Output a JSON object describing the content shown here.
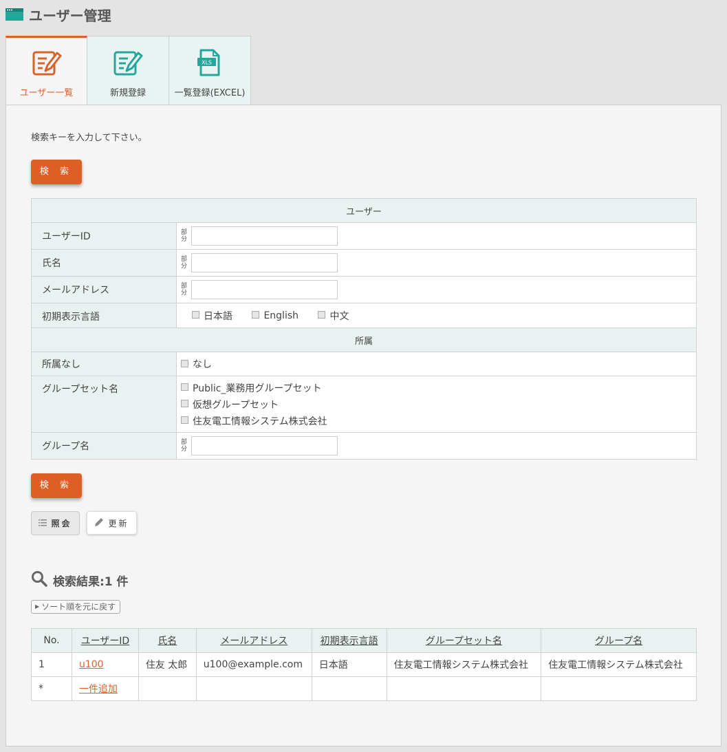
{
  "page": {
    "title": "ユーザー管理"
  },
  "tabs": [
    {
      "label": "ユーザー一覧",
      "active": true
    },
    {
      "label": "新規登録",
      "active": false
    },
    {
      "label": "一覧登録(EXCEL)",
      "active": false,
      "icon_text": "XLS"
    }
  ],
  "colors": {
    "accent": "#dc5f26",
    "teal": "#26a69a",
    "header_bg": "#eaf2f1"
  },
  "search": {
    "instruction": "検索キーを入力して下さい。",
    "button_label": "検 索",
    "partial_mark": "部分",
    "user_section": "ユーザー",
    "fields": {
      "user_id": "ユーザーID",
      "name": "氏名",
      "email": "メールアドレス",
      "language": "初期表示言語"
    },
    "languages": [
      "日本語",
      "English",
      "中文"
    ],
    "affiliation_section": "所属",
    "no_affiliation_label": "所属なし",
    "no_affiliation_option": "なし",
    "group_set_label": "グループセット名",
    "group_sets": [
      "Public_業務用グループセット",
      "仮想グループセット",
      "住友電工情報システム株式会社"
    ],
    "group_name_label": "グループ名"
  },
  "mode_buttons": {
    "view": "照会",
    "update": "更新"
  },
  "results": {
    "title": "検索結果:1 件",
    "sort_reset": "ソート順を元に戻す",
    "columns": [
      "No.",
      "ユーザーID",
      "氏名",
      "メールアドレス",
      "初期表示言語",
      "グループセット名",
      "グループ名"
    ],
    "rows": [
      {
        "no": "1",
        "user_id": "u100",
        "name": "住友 太郎",
        "email": "u100@example.com",
        "language": "日本語",
        "group_set": "住友電工情報システム株式会社",
        "group": "住友電工情報システム株式会社"
      }
    ],
    "add_row": {
      "no": "*",
      "label": "一件追加"
    }
  }
}
